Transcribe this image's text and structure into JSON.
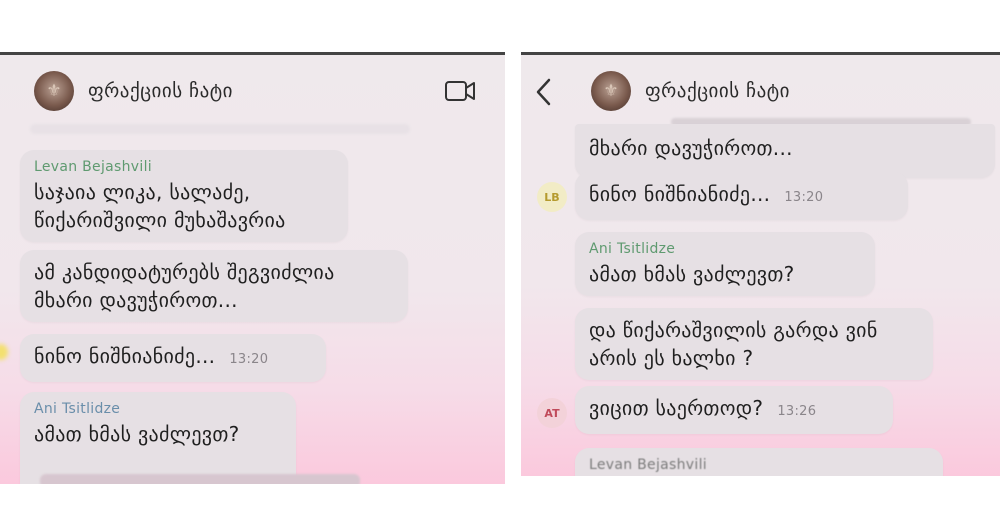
{
  "left": {
    "chat_title": "ფრაქციის ჩატი",
    "msg1": {
      "sender": "Levan Bejashvili",
      "line1": "საჯაია ლიკა, სალაძე,",
      "line2": "წიქარიშვილი მუხაშავრია"
    },
    "msg2": {
      "line1": "ამ კანდიდატურებს შეგვიძლია",
      "line2": "მხარი დავუჭიროთ..."
    },
    "msg3": {
      "text": "ნინო ნიშნიანიძე...",
      "time": "13:20"
    },
    "msg4": {
      "sender": "Ani Tsitlidze",
      "text": "ამათ ხმას ვაძლევთ?"
    }
  },
  "right": {
    "chat_title": "ფრაქციის ჩატი",
    "msg1": {
      "text": "მხარი დავუჭიროთ..."
    },
    "msg2": {
      "avatar": "LB",
      "text": "ნინო ნიშნიანიძე...",
      "time": "13:20"
    },
    "msg3": {
      "sender": "Ani Tsitlidze",
      "text": "ამათ ხმას ვაძლევთ?"
    },
    "msg4": {
      "line1": "და წიქარაშვილის გარდა ვინ",
      "line2": "არის ეს ხალხი ?"
    },
    "msg5": {
      "avatar": "AT",
      "text": "ვიცით საერთოდ?",
      "time": "13:26"
    },
    "msg6": {
      "sender": "Levan Bejashvili"
    }
  },
  "colors": {
    "sender_green": "#5f9a70",
    "sender_blue": "#6a8eaa",
    "lb_avatar_bg": "#f2ecc6",
    "lb_avatar_text": "#b59a2e",
    "at_avatar_bg": "#f3d2d9",
    "at_avatar_text": "#c04a5a"
  },
  "icons": [
    "video-call-icon",
    "back-chevron-icon"
  ]
}
